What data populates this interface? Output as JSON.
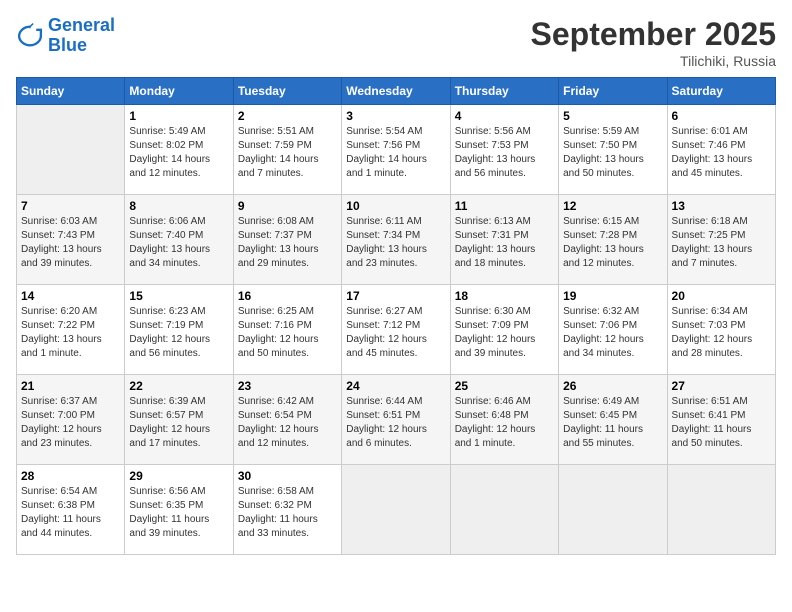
{
  "logo": {
    "line1": "General",
    "line2": "Blue"
  },
  "title": "September 2025",
  "location": "Tilichiki, Russia",
  "days_of_week": [
    "Sunday",
    "Monday",
    "Tuesday",
    "Wednesday",
    "Thursday",
    "Friday",
    "Saturday"
  ],
  "weeks": [
    [
      {
        "num": "",
        "info": ""
      },
      {
        "num": "1",
        "info": "Sunrise: 5:49 AM\nSunset: 8:02 PM\nDaylight: 14 hours\nand 12 minutes."
      },
      {
        "num": "2",
        "info": "Sunrise: 5:51 AM\nSunset: 7:59 PM\nDaylight: 14 hours\nand 7 minutes."
      },
      {
        "num": "3",
        "info": "Sunrise: 5:54 AM\nSunset: 7:56 PM\nDaylight: 14 hours\nand 1 minute."
      },
      {
        "num": "4",
        "info": "Sunrise: 5:56 AM\nSunset: 7:53 PM\nDaylight: 13 hours\nand 56 minutes."
      },
      {
        "num": "5",
        "info": "Sunrise: 5:59 AM\nSunset: 7:50 PM\nDaylight: 13 hours\nand 50 minutes."
      },
      {
        "num": "6",
        "info": "Sunrise: 6:01 AM\nSunset: 7:46 PM\nDaylight: 13 hours\nand 45 minutes."
      }
    ],
    [
      {
        "num": "7",
        "info": "Sunrise: 6:03 AM\nSunset: 7:43 PM\nDaylight: 13 hours\nand 39 minutes."
      },
      {
        "num": "8",
        "info": "Sunrise: 6:06 AM\nSunset: 7:40 PM\nDaylight: 13 hours\nand 34 minutes."
      },
      {
        "num": "9",
        "info": "Sunrise: 6:08 AM\nSunset: 7:37 PM\nDaylight: 13 hours\nand 29 minutes."
      },
      {
        "num": "10",
        "info": "Sunrise: 6:11 AM\nSunset: 7:34 PM\nDaylight: 13 hours\nand 23 minutes."
      },
      {
        "num": "11",
        "info": "Sunrise: 6:13 AM\nSunset: 7:31 PM\nDaylight: 13 hours\nand 18 minutes."
      },
      {
        "num": "12",
        "info": "Sunrise: 6:15 AM\nSunset: 7:28 PM\nDaylight: 13 hours\nand 12 minutes."
      },
      {
        "num": "13",
        "info": "Sunrise: 6:18 AM\nSunset: 7:25 PM\nDaylight: 13 hours\nand 7 minutes."
      }
    ],
    [
      {
        "num": "14",
        "info": "Sunrise: 6:20 AM\nSunset: 7:22 PM\nDaylight: 13 hours\nand 1 minute."
      },
      {
        "num": "15",
        "info": "Sunrise: 6:23 AM\nSunset: 7:19 PM\nDaylight: 12 hours\nand 56 minutes."
      },
      {
        "num": "16",
        "info": "Sunrise: 6:25 AM\nSunset: 7:16 PM\nDaylight: 12 hours\nand 50 minutes."
      },
      {
        "num": "17",
        "info": "Sunrise: 6:27 AM\nSunset: 7:12 PM\nDaylight: 12 hours\nand 45 minutes."
      },
      {
        "num": "18",
        "info": "Sunrise: 6:30 AM\nSunset: 7:09 PM\nDaylight: 12 hours\nand 39 minutes."
      },
      {
        "num": "19",
        "info": "Sunrise: 6:32 AM\nSunset: 7:06 PM\nDaylight: 12 hours\nand 34 minutes."
      },
      {
        "num": "20",
        "info": "Sunrise: 6:34 AM\nSunset: 7:03 PM\nDaylight: 12 hours\nand 28 minutes."
      }
    ],
    [
      {
        "num": "21",
        "info": "Sunrise: 6:37 AM\nSunset: 7:00 PM\nDaylight: 12 hours\nand 23 minutes."
      },
      {
        "num": "22",
        "info": "Sunrise: 6:39 AM\nSunset: 6:57 PM\nDaylight: 12 hours\nand 17 minutes."
      },
      {
        "num": "23",
        "info": "Sunrise: 6:42 AM\nSunset: 6:54 PM\nDaylight: 12 hours\nand 12 minutes."
      },
      {
        "num": "24",
        "info": "Sunrise: 6:44 AM\nSunset: 6:51 PM\nDaylight: 12 hours\nand 6 minutes."
      },
      {
        "num": "25",
        "info": "Sunrise: 6:46 AM\nSunset: 6:48 PM\nDaylight: 12 hours\nand 1 minute."
      },
      {
        "num": "26",
        "info": "Sunrise: 6:49 AM\nSunset: 6:45 PM\nDaylight: 11 hours\nand 55 minutes."
      },
      {
        "num": "27",
        "info": "Sunrise: 6:51 AM\nSunset: 6:41 PM\nDaylight: 11 hours\nand 50 minutes."
      }
    ],
    [
      {
        "num": "28",
        "info": "Sunrise: 6:54 AM\nSunset: 6:38 PM\nDaylight: 11 hours\nand 44 minutes."
      },
      {
        "num": "29",
        "info": "Sunrise: 6:56 AM\nSunset: 6:35 PM\nDaylight: 11 hours\nand 39 minutes."
      },
      {
        "num": "30",
        "info": "Sunrise: 6:58 AM\nSunset: 6:32 PM\nDaylight: 11 hours\nand 33 minutes."
      },
      {
        "num": "",
        "info": ""
      },
      {
        "num": "",
        "info": ""
      },
      {
        "num": "",
        "info": ""
      },
      {
        "num": "",
        "info": ""
      }
    ]
  ]
}
